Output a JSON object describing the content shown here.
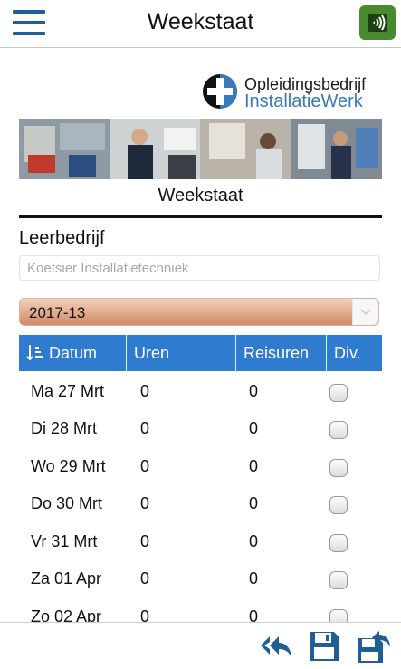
{
  "header": {
    "title": "Weekstaat",
    "menu_icon": "hamburger-menu-icon",
    "nfc_icon": "nfc-wireless-icon",
    "nfc_color": "#4a8a2e",
    "accent_color": "#1f5f95"
  },
  "logo": {
    "line1": "Opleidingsbedrijf",
    "line2": "InstallatieWerk",
    "brand_blue": "#3a79b8"
  },
  "page": {
    "subtitle": "Weekstaat",
    "company_label": "Leerbedrijf",
    "company_placeholder": "Koetsier Installatietechniek",
    "week_value": "2017-13",
    "week_options": [
      "2017-13"
    ]
  },
  "table": {
    "header_color": "#2f7bd0",
    "columns": [
      "Datum",
      "Uren",
      "Reisuren",
      "Div."
    ],
    "sort_icon": "sort-ascending-icon",
    "rows": [
      {
        "date": "Ma 27 Mrt",
        "hours": "0",
        "travel": "0",
        "div": false
      },
      {
        "date": "Di 28 Mrt",
        "hours": "0",
        "travel": "0",
        "div": false
      },
      {
        "date": "Wo 29 Mrt",
        "hours": "0",
        "travel": "0",
        "div": false
      },
      {
        "date": "Do 30 Mrt",
        "hours": "0",
        "travel": "0",
        "div": false
      },
      {
        "date": "Vr 31 Mrt",
        "hours": "0",
        "travel": "0",
        "div": false
      },
      {
        "date": "Za 01 Apr",
        "hours": "0",
        "travel": "0",
        "div": false
      },
      {
        "date": "Zo 02 Apr",
        "hours": "0",
        "travel": "0",
        "div": false
      }
    ]
  },
  "toolbar": {
    "reply_icon": "reply-all-icon",
    "save_icon": "save-icon",
    "save_send_icon": "save-and-send-icon",
    "icon_color": "#1f5f95"
  }
}
